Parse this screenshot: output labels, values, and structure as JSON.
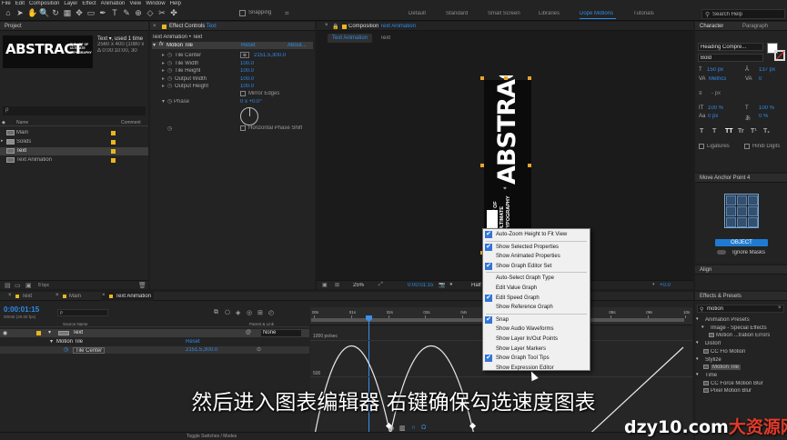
{
  "menu": [
    "File",
    "Edit",
    "Composition",
    "Layer",
    "Effect",
    "Animation",
    "View",
    "Window",
    "Help"
  ],
  "toolbar": {
    "icons": [
      "home-icon",
      "arrow-icon",
      "hand-icon",
      "zoom-icon",
      "rotate-icon",
      "camera-icon",
      "pan-icon",
      "rect-icon",
      "pen-icon",
      "type-icon",
      "brush-icon",
      "stamp-icon",
      "eraser-icon",
      "roto-icon",
      "puppet-icon"
    ],
    "snapping": "Snapping",
    "workspaces": [
      "Default",
      "Standard",
      "Small Screen",
      "Libraries",
      "Dope Motions",
      "Tutorials"
    ],
    "active_workspace": "Dope Motions",
    "search": "Search Help"
  },
  "project": {
    "tab": "Project",
    "thumb_title": "ABSTRACT",
    "thumb_lines": [
      "THE ART OF",
      "ULTIMATE",
      "TYPOGRAPHY"
    ],
    "item_name": "Text",
    "item_used": ", used 1 time",
    "item_dims": "2560 x 400  (1080 x",
    "item_dur": "Δ 0:00:10:00, 30",
    "search_placeholder": "ρ",
    "col_name": "Name",
    "col_comment": "Comment",
    "items": [
      "Main",
      "Solids",
      "Text",
      "Text Animation"
    ],
    "bpc": "8 bpc"
  },
  "effects": {
    "tab_prefix": "Effect Controls",
    "tab_layer": "Text",
    "breadcrumb": "Text Animation • Text",
    "fx_name": "Motion Tile",
    "reset": "Reset",
    "about": "About...",
    "props": [
      {
        "name": "Tile Center",
        "value": "2151.5,300.0"
      },
      {
        "name": "Tile Width",
        "value": "100.0"
      },
      {
        "name": "Tile Height",
        "value": "100.0"
      },
      {
        "name": "Output Width",
        "value": "100.0"
      },
      {
        "name": "Output Height",
        "value": "100.0"
      }
    ],
    "mirror": "Mirror Edges",
    "phase": "Phase",
    "phase_val": "0 x +0.0°",
    "hshift": "Horizontal Phase Shift"
  },
  "comp": {
    "tab_prefix": "Composition",
    "tab_name": "Text Animation",
    "sub_tabs": [
      "Text Animation",
      "Text"
    ],
    "big": "ABSTRACT",
    "lines": [
      "THE ART OF",
      "ULTIMATE",
      "TYPOGRAPHY"
    ],
    "zoom": "25%",
    "time": "0:00:01:15",
    "res": "Half",
    "exposure": "+0.0"
  },
  "character": {
    "tab": "Character",
    "tab2": "Paragraph",
    "font": "Heading Compre...",
    "style": "Bold",
    "size": "150 px",
    "leading": "137 px",
    "kerning": "Metrics",
    "tracking": "0",
    "stroke": "- px",
    "vscale": "100 %",
    "hscale": "100 %",
    "baseline": "0 px",
    "tsume": "0 %",
    "ligatures": "Ligatures",
    "hindi": "Hindi Digits"
  },
  "anchor": {
    "title": "Move Anchor Point 4",
    "button": "OBJECT",
    "ignore": "Ignore Masks"
  },
  "align": {
    "tab": "Align"
  },
  "fx_presets": {
    "tab": "Effects & Presets",
    "search": "motion",
    "tree": [
      "Animation Presets",
      "Image - Special Effects",
      "Motion ...tration Errors",
      "Distort",
      "CC Flo Motion",
      "Stylize",
      "Motion Tile",
      "Time",
      "CC Force Motion Blur",
      "Pixel Motion Blur"
    ]
  },
  "timeline": {
    "tabs": [
      "Text",
      "Main",
      "Text Animation"
    ],
    "time": "0:00:01:15",
    "frames": "00045 (30.00 fps)",
    "col_source": "Source Name",
    "col_parent": "Parent & Link",
    "layer_name": "Text",
    "parent": "None",
    "fx_name": "Motion Tile",
    "fx_reset": "Reset",
    "prop": "Tile Center",
    "prop_val": "2151.5,300.0",
    "ruler": [
      "00s",
      "01s",
      "02s",
      "03s",
      "04s",
      "05s",
      "06s",
      "07s",
      "08s",
      "09s",
      "10s"
    ],
    "graph_top": "1000 px/sec",
    "graph_mid": "500",
    "toggle": "Toggle Switches / Modes"
  },
  "context_menu": [
    {
      "label": "Auto-Zoom Height to Fit View",
      "checked": true
    },
    {
      "sep": true
    },
    {
      "label": "Show Selected Properties",
      "checked": true
    },
    {
      "label": "Show Animated Properties",
      "checked": false
    },
    {
      "label": "Show Graph Editor Set",
      "checked": true
    },
    {
      "sep": true
    },
    {
      "label": "Auto-Select Graph Type",
      "checked": false
    },
    {
      "label": "Edit Value Graph",
      "checked": false
    },
    {
      "label": "Edit Speed Graph",
      "checked": true
    },
    {
      "label": "Show Reference Graph",
      "checked": false
    },
    {
      "sep": true
    },
    {
      "label": "Snap",
      "checked": true
    },
    {
      "label": "Show Audio Waveforms",
      "checked": false
    },
    {
      "label": "Show Layer In/Out Points",
      "checked": false
    },
    {
      "label": "Show Layer Markers",
      "checked": false
    },
    {
      "label": "Show Graph Tool Tips",
      "checked": true
    },
    {
      "label": "Show Expression Editor",
      "checked": false
    }
  ],
  "subtitle": "然后进入图表编辑器 右键确保勾选速度图表",
  "watermark_a": "dzy10.com",
  "watermark_b": "大资源网",
  "colors": {
    "accent": "#2d8ceb",
    "label": "#e8b71f",
    "menu_check": "#3275d6"
  }
}
